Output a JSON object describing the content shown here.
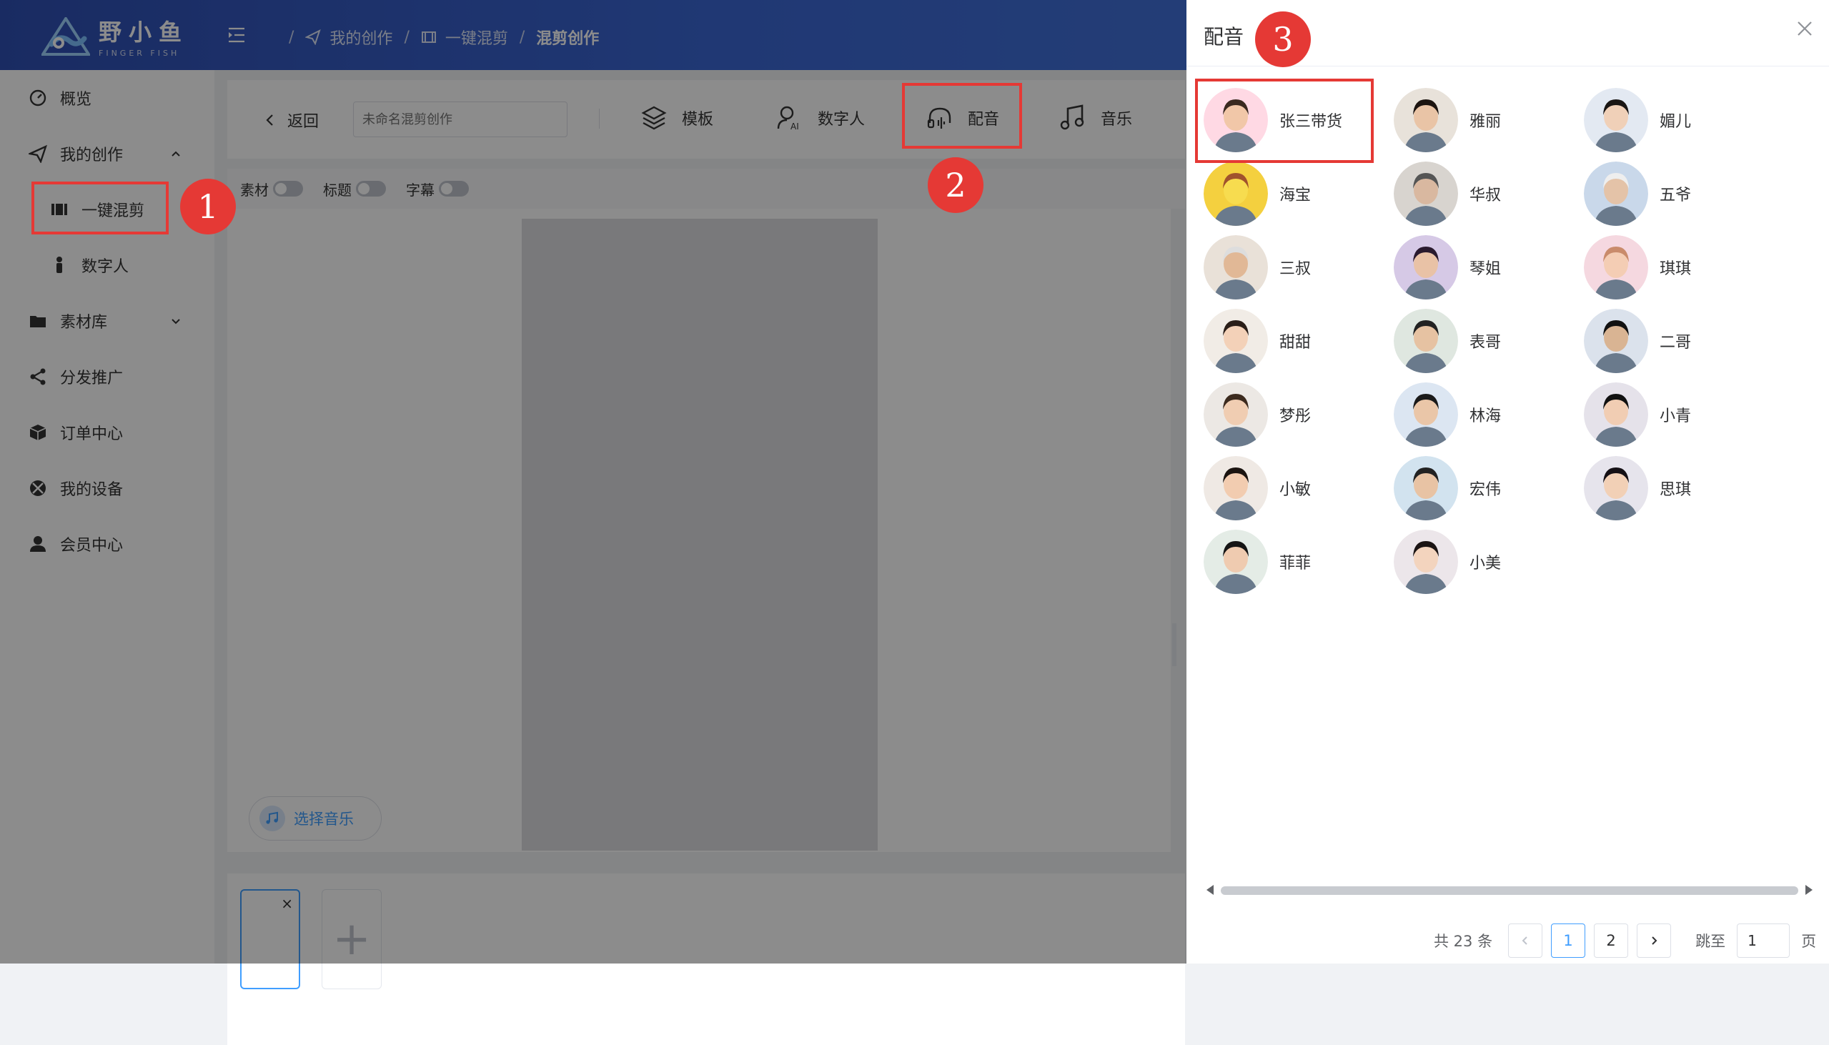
{
  "brand": {
    "name_cn": "野小鱼",
    "name_en": "FINGER FISH"
  },
  "breadcrumb": {
    "items": [
      "我的创作",
      "一键混剪",
      "混剪创作"
    ],
    "sep": "/"
  },
  "sidebar": {
    "items": [
      {
        "label": "概览",
        "icon": "dashboard-icon"
      },
      {
        "label": "我的创作",
        "icon": "paper-plane-icon",
        "expanded": true
      },
      {
        "label": "一键混剪",
        "icon": "film-icon",
        "sub": true,
        "active": true
      },
      {
        "label": "数字人",
        "icon": "person-icon",
        "sub": true
      },
      {
        "label": "素材库",
        "icon": "folder-icon",
        "collapsible": true
      },
      {
        "label": "分发推广",
        "icon": "share-icon"
      },
      {
        "label": "订单中心",
        "icon": "box-icon"
      },
      {
        "label": "我的设备",
        "icon": "xbox-icon"
      },
      {
        "label": "会员中心",
        "icon": "user-icon"
      }
    ]
  },
  "toolbar": {
    "back_label": "返回",
    "name_placeholder": "未命名混剪创作",
    "tools": [
      "模板",
      "数字人",
      "配音",
      "音乐"
    ]
  },
  "options": {
    "material": "素材",
    "title": "标题",
    "subtitle": "字幕"
  },
  "music_button": "选择音乐",
  "clips": {
    "close": "×",
    "add": "+"
  },
  "drawer": {
    "title": "配音",
    "voices": [
      "张三带货",
      "雅丽",
      "媚儿",
      "海宝",
      "华叔",
      "五爷",
      "三叔",
      "琴姐",
      "琪琪",
      "甜甜",
      "表哥",
      "二哥",
      "梦彤",
      "林海",
      "小青",
      "小敏",
      "宏伟",
      "思琪",
      "菲菲",
      "小美"
    ],
    "pager": {
      "total": "共 23 条",
      "pages": [
        "1",
        "2"
      ],
      "current": 1,
      "jump_label": "跳至",
      "jump_value": "1",
      "page_suffix": "页"
    }
  },
  "annotations": [
    "1",
    "2",
    "3"
  ],
  "colors": {
    "header": "#3b67d4",
    "accent": "#409eff",
    "annotation": "#e53935"
  }
}
